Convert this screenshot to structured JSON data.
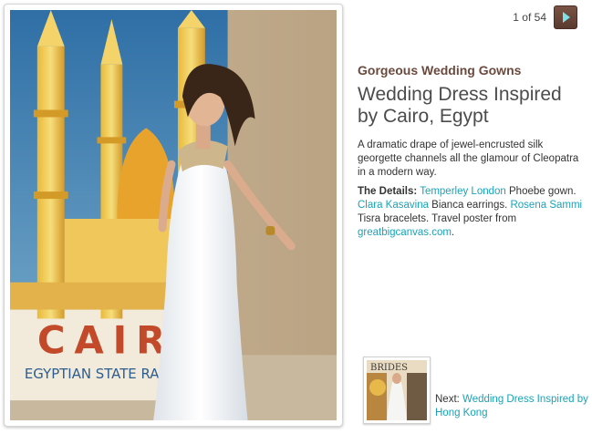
{
  "pager": {
    "count": "1 of 54"
  },
  "article": {
    "category": "Gorgeous Wedding Gowns",
    "title": "Wedding Dress Inspired by Cairo, Egypt",
    "description": "A dramatic drape of jewel-encrusted silk georgette channels all the glamour of Cleopatra in a modern way."
  },
  "details": {
    "label": "The Details:",
    "designer_link": "Temperley London",
    "designer_item": " Phoebe gown. ",
    "earrings_link": "Clara Kasavina",
    "earrings_item": " Bianca earrings. ",
    "bracelets_link": "Rosena Sammi",
    "bracelets_item": " Tisra bracelets. Travel poster from ",
    "poster_link": "greatbigcanvas.com",
    "end": "."
  },
  "poster": {
    "city": "CAIR",
    "subtitle": "EGYPTIAN STATE RAI"
  },
  "thumbnail": {
    "magazine": "BRIDES"
  },
  "next": {
    "prefix": "Next: ",
    "link": "Wedding Dress Inspired by Hong Kong"
  },
  "colors": {
    "accent_link": "#19a3b8",
    "category": "#6b4a3e",
    "button": "#5a3a2e"
  }
}
